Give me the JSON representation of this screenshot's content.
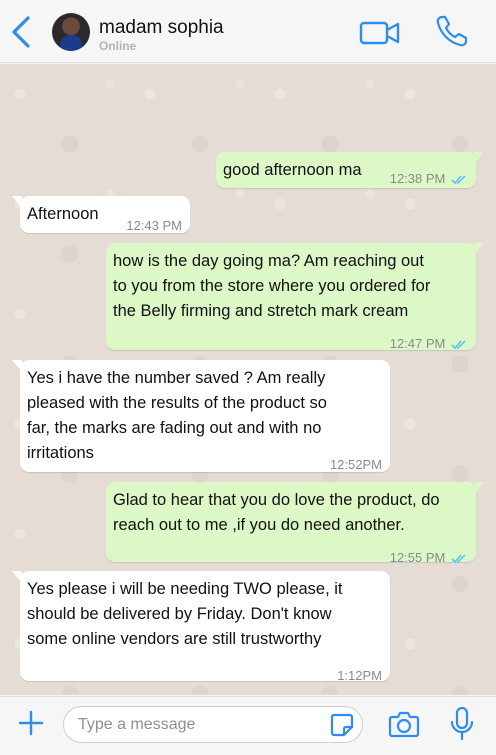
{
  "header": {
    "contact_name": "madam sophia",
    "status": "Online"
  },
  "colors": {
    "accent": "#2e8cf0",
    "outgoing_bubble": "#dcf8c6",
    "incoming_bubble": "#ffffff",
    "chat_background": "#e5ddd5",
    "read_ticks": "#4fc3f7"
  },
  "messages": [
    {
      "direction": "out",
      "text": "good afternoon ma",
      "time": "12:38 PM",
      "read": true
    },
    {
      "direction": "in",
      "text": "Afternoon",
      "time": "12:43 PM"
    },
    {
      "direction": "out",
      "text_lines": [
        "how is the day going ma? Am reaching out",
        "to you from the store where you ordered for",
        "the Belly firming and stretch mark cream"
      ],
      "time": "12:47 PM",
      "read": true
    },
    {
      "direction": "in",
      "text_lines": [
        "Yes i have the number saved ? Am really",
        "pleased with the results of the product so",
        "far, the marks are fading out and with no",
        "irritations"
      ],
      "time": "12:52PM"
    },
    {
      "direction": "out",
      "text_lines": [
        "Glad to hear that you do love the product, do",
        "reach out to me ,if you do need another."
      ],
      "time": "12:55 PM",
      "read": true
    },
    {
      "direction": "in",
      "text_lines": [
        "Yes please i will be needing TWO please, it",
        "should be delivered by Friday. Don't know",
        "some online vendors are still trustworthy"
      ],
      "time": "1:12PM"
    }
  ],
  "composer": {
    "placeholder": "Type a message",
    "value": ""
  },
  "icons": {
    "back": "back-chevron-icon",
    "video": "video-camera-icon",
    "call": "phone-icon",
    "add": "plus-icon",
    "sticker": "sticker-icon",
    "camera": "camera-icon",
    "mic": "microphone-icon"
  }
}
